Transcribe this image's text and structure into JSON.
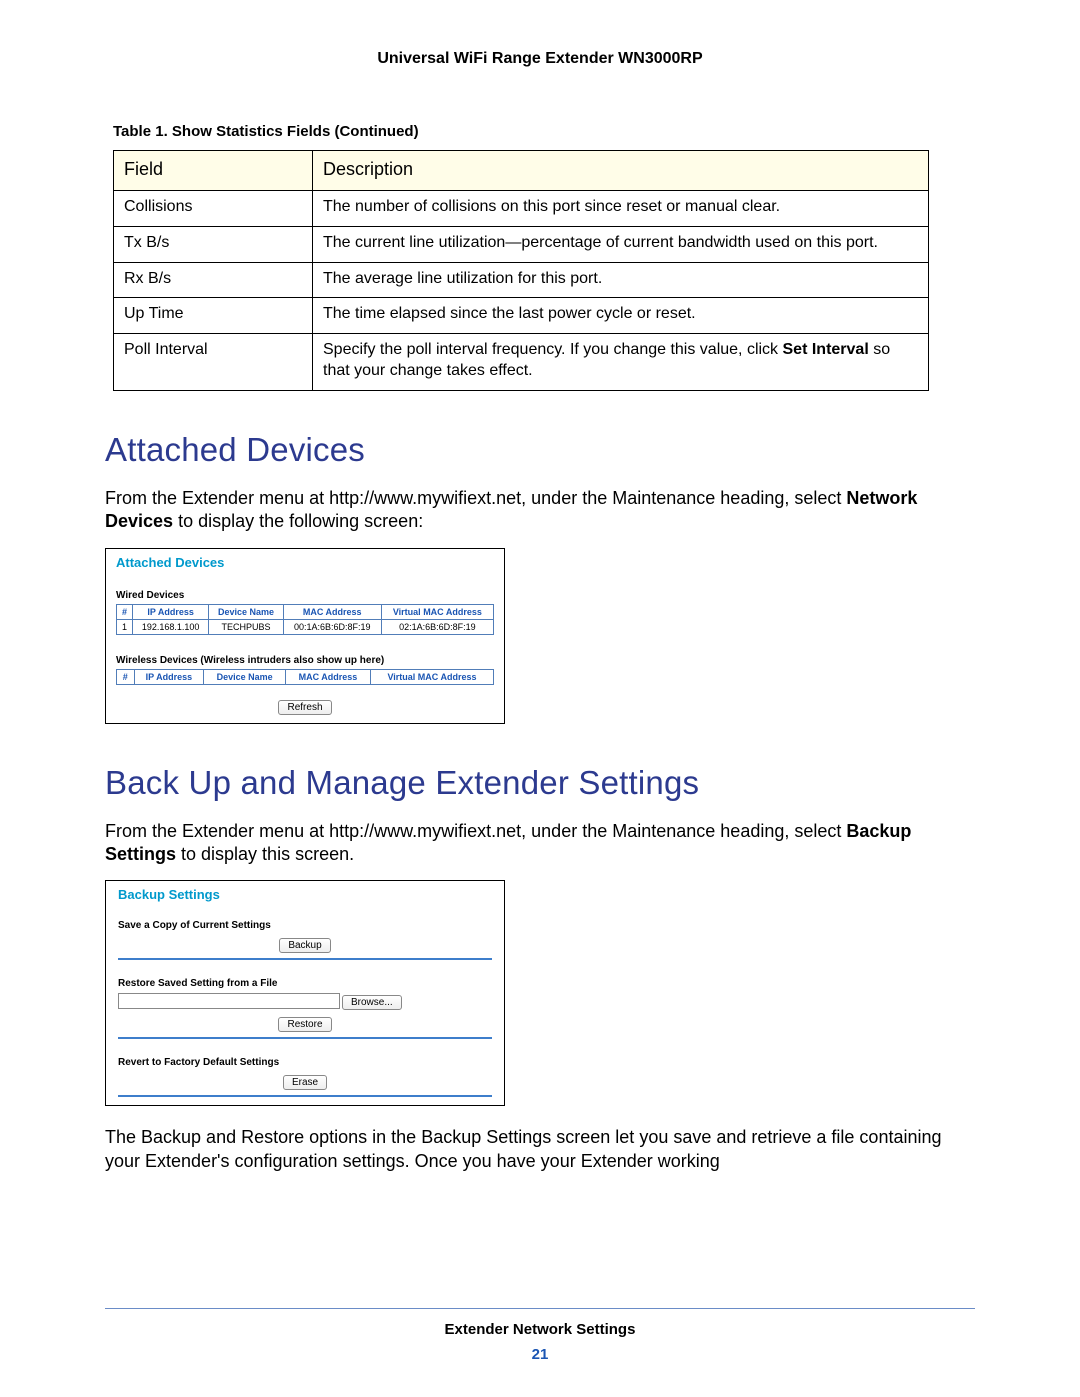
{
  "header": {
    "title": "Universal WiFi Range Extender WN3000RP"
  },
  "table": {
    "caption": "Table 1.  Show Statistics Fields (Continued)",
    "cols": [
      "Field",
      "Description"
    ],
    "rows": [
      {
        "field": "Collisions",
        "desc": "The number of collisions on this port since reset or manual clear."
      },
      {
        "field": "Tx B/s",
        "desc": "The current line utilization—percentage of current bandwidth used on this port."
      },
      {
        "field": "Rx B/s",
        "desc": "The average line utilization for this port."
      },
      {
        "field": "Up Time",
        "desc": "The time elapsed since the last power cycle or reset."
      },
      {
        "field": "Poll Interval",
        "desc_pre": "Specify the poll interval frequency. If you change this value, click ",
        "bold1": "Set Interval",
        "desc_post": " so that your change takes effect."
      }
    ]
  },
  "sec1": {
    "heading": "Attached Devices",
    "p1a": "From the Extender menu at http://www.mywifiext.net, under the Maintenance heading, select ",
    "p1b": "Network Devices",
    "p1c": " to display the following screen:"
  },
  "shot1": {
    "title": "Attached Devices",
    "wired_label": "Wired Devices",
    "wired_headers": [
      "#",
      "IP Address",
      "Device Name",
      "MAC Address",
      "Virtual MAC Address"
    ],
    "wired_row": [
      "1",
      "192.168.1.100",
      "TECHPUBS",
      "00:1A:6B:6D:8F:19",
      "02:1A:6B:6D:8F:19"
    ],
    "wireless_label": "Wireless Devices (Wireless intruders also show up here)",
    "wireless_headers": [
      "#",
      "IP Address",
      "Device Name",
      "MAC Address",
      "Virtual MAC Address"
    ],
    "refresh": "Refresh"
  },
  "sec2": {
    "heading": "Back Up and Manage Extender Settings",
    "p1a": "From the Extender menu at http://www.mywifiext.net, under the Maintenance heading, select ",
    "p1b": "Backup Settings",
    "p1c": " to display this screen."
  },
  "shot2": {
    "title": "Backup Settings",
    "save_label": "Save a Copy of Current Settings",
    "backup_btn": "Backup",
    "restore_label": "Restore Saved Setting from a File",
    "browse_btn": "Browse...",
    "restore_btn": "Restore",
    "revert_label": "Revert to Factory Default Settings",
    "erase_btn": "Erase"
  },
  "trailing_p": "The Backup and Restore options in the Backup Settings screen let you save and retrieve a file containing your Extender's configuration settings. Once you have your Extender working",
  "footer": {
    "section": "Extender Network Settings",
    "page": "21"
  }
}
